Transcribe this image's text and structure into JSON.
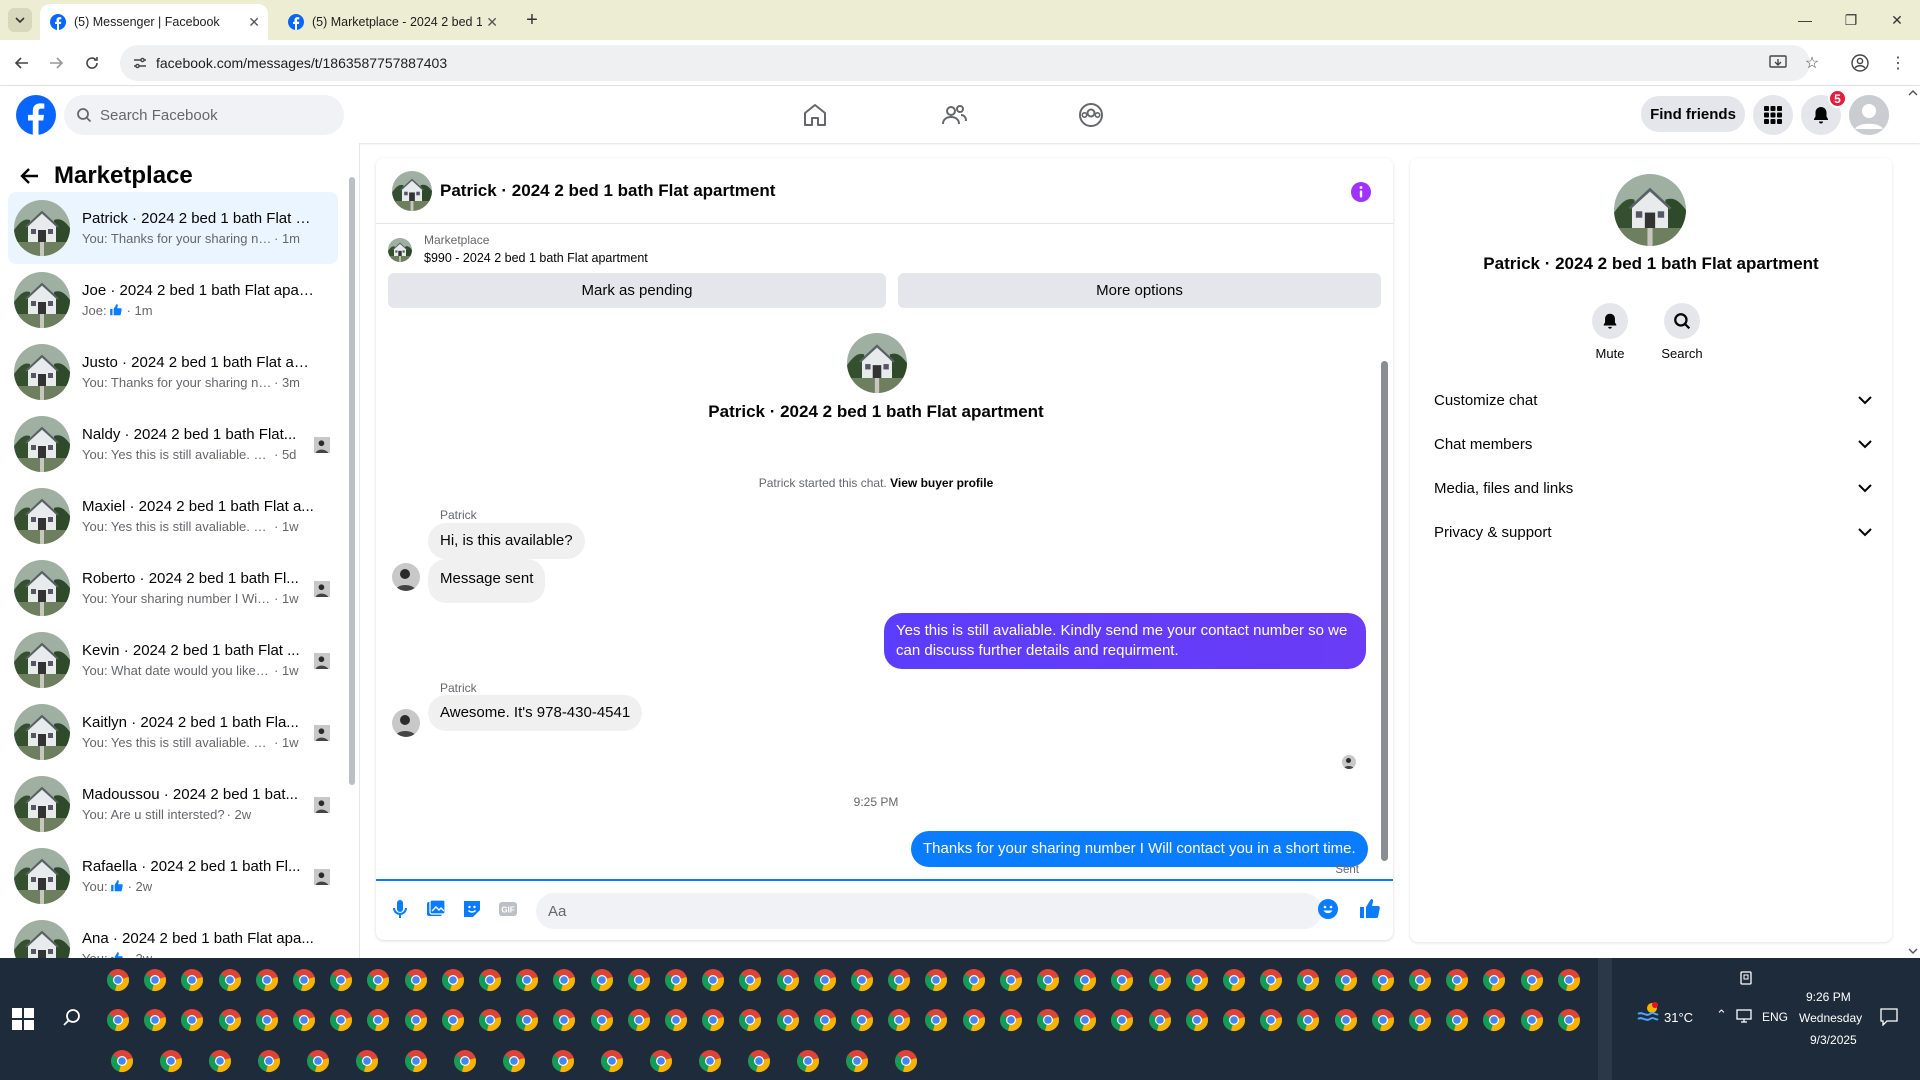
{
  "browser": {
    "tabs": [
      {
        "title": "(5) Messenger | Facebook",
        "active": true
      },
      {
        "title": "(5) Marketplace - 2024 2 bed 1",
        "active": false
      }
    ],
    "url": "facebook.com/messages/t/1863587757887403"
  },
  "fb_header": {
    "search_placeholder": "Search Facebook",
    "find_friends": "Find friends",
    "notification_count": "5"
  },
  "sidebar": {
    "title": "Marketplace",
    "conversations": [
      {
        "name": "Patrick · 2024 2 bed 1 bath Flat a...",
        "preview": "You: Thanks for your sharing numb...",
        "time": "· 1m",
        "like": false,
        "active": true
      },
      {
        "name": "Joe · 2024 2 bed 1 bath Flat apar...",
        "preview": "Joe: ",
        "time": "· 1m",
        "like": true
      },
      {
        "name": "Justo · 2024 2 bed 1 bath Flat ap...",
        "preview": "You: Thanks for your sharing numb...",
        "time": "· 3m",
        "like": false
      },
      {
        "name": "Naldy · 2024 2 bed 1 bath Flat...",
        "preview": "You: Yes this is still avaliable. Kin...",
        "time": "· 5d",
        "like": false,
        "seen": true
      },
      {
        "name": "Maxiel · 2024 2 bed 1 bath Flat a...",
        "preview": "You: Yes this is still avaliable. Kindly...",
        "time": "· 1w",
        "like": false
      },
      {
        "name": "Roberto · 2024 2 bed 1 bath Fl...",
        "preview": "You: Your sharing number I Will ...",
        "time": "· 1w",
        "like": false,
        "seen": true
      },
      {
        "name": "Kevin · 2024 2 bed 1 bath Flat ...",
        "preview": "You: What date would you like t...",
        "time": "· 1w",
        "like": false,
        "seen": true
      },
      {
        "name": "Kaitlyn · 2024 2 bed 1 bath Fla...",
        "preview": "You: Yes this is still avaliable. Kin...",
        "time": "· 1w",
        "like": false,
        "seen": true
      },
      {
        "name": "Madoussou · 2024 2 bed 1 bat...",
        "preview": "You: Are u still intersted?",
        "time": "· 2w",
        "like": false,
        "seen": true
      },
      {
        "name": "Rafaella · 2024 2 bed 1 bath Fl...",
        "preview": "You: ",
        "time": "· 2w",
        "like": true,
        "seen": true
      },
      {
        "name": "Ana · 2024 2 bed 1 bath Flat apa...",
        "preview": "You: ",
        "time": "· 2w",
        "like": true
      }
    ]
  },
  "chat": {
    "title": "Patrick · 2024 2 bed 1 bath Flat apartment",
    "marketplace_label": "Marketplace",
    "listing": "$990 - 2024 2 bed 1 bath Flat apartment",
    "mark_pending": "Mark as pending",
    "more_options": "More options",
    "started_text": "Patrick started this chat.",
    "view_profile": "View buyer profile",
    "sender_name": "Patrick",
    "messages": [
      {
        "text": "Hi, is this available?"
      },
      {
        "text": "Message sent"
      },
      {
        "text": "Yes this is still avaliable. Kindly send me your contact number so we can discuss further details and requirment."
      },
      {
        "text": "Awesome. It's 978-430-4541"
      },
      {
        "text": "Thanks for your sharing number I Will contact you in a short time."
      }
    ],
    "timestamp": "9:25 PM",
    "sent_label": "Sent",
    "composer_placeholder": "Aa"
  },
  "details": {
    "name": "Patrick · 2024 2 bed 1 bath Flat apartment",
    "mute": "Mute",
    "search": "Search",
    "sections": [
      "Customize chat",
      "Chat members",
      "Media, files and links",
      "Privacy & support"
    ]
  },
  "taskbar": {
    "temperature": "31°C",
    "language": "ENG",
    "time": "9:26 PM",
    "day": "Wednesday",
    "date": "9/3/2025"
  },
  "colors": {
    "fb_blue": "#0866ff",
    "bubble_blue": "#0a7cff",
    "bubble_purple": "#5b3dff",
    "info_purple": "#a033ff"
  }
}
